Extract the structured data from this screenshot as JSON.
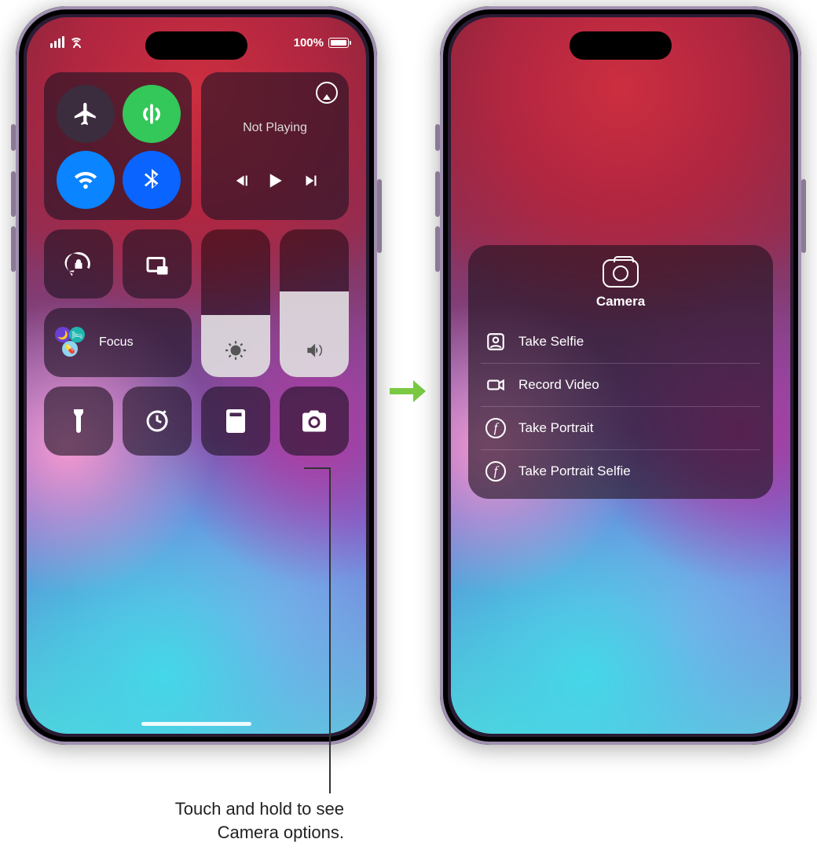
{
  "status": {
    "battery_pct": "100%"
  },
  "media": {
    "now_playing": "Not Playing"
  },
  "focus": {
    "label": "Focus"
  },
  "camera_popup": {
    "title": "Camera",
    "items": [
      {
        "label": "Take Selfie"
      },
      {
        "label": "Record Video"
      },
      {
        "label": "Take Portrait"
      },
      {
        "label": "Take Portrait Selfie"
      }
    ]
  },
  "callout": {
    "text": "Touch and hold to see Camera options."
  },
  "icons": {
    "airplane": "airplane-icon",
    "cellular": "cellular-icon",
    "wifi": "wifi-icon",
    "bluetooth": "bluetooth-icon",
    "airplay": "airplay-icon",
    "prev": "previous-track-icon",
    "play": "play-icon",
    "next": "next-track-icon",
    "rotation_lock": "rotation-lock-icon",
    "screen_mirror": "screen-mirroring-icon",
    "brightness": "brightness-icon",
    "volume": "volume-icon",
    "flashlight": "flashlight-icon",
    "timer": "timer-icon",
    "calculator": "calculator-icon",
    "camera": "camera-icon",
    "selfie": "selfie-person-icon",
    "video": "video-camera-icon",
    "portrait": "portrait-aperture-icon"
  },
  "colors": {
    "toggle_on_green": "#34c759",
    "toggle_on_blue": "#0a84ff",
    "arrow_green": "#7ac943"
  }
}
